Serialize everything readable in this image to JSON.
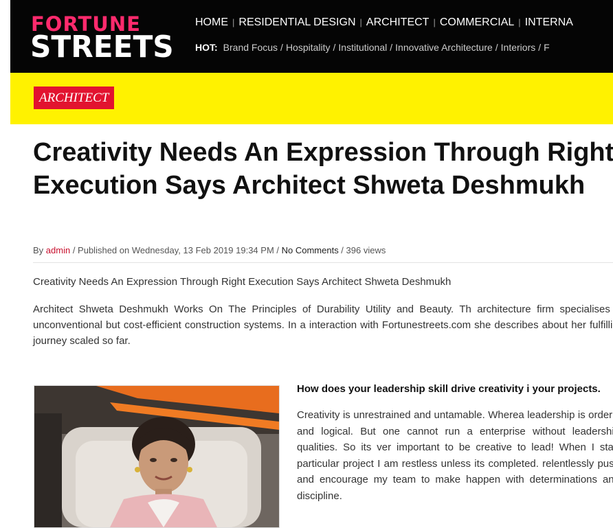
{
  "site": {
    "logo_top": "FORTUNE",
    "logo_bottom": "STREETS"
  },
  "nav": {
    "items": [
      "HOME",
      "RESIDENTIAL DESIGN",
      "ARCHITECT",
      "COMMERCIAL",
      "INTERNA"
    ]
  },
  "hot": {
    "label": "HOT:",
    "links": [
      "Brand Focus",
      "Hospitality",
      "Institutional",
      "Innovative Architecture",
      "Interiors",
      "F"
    ]
  },
  "category": {
    "badge": "ARCHITECT"
  },
  "article": {
    "title": "Creativity Needs An Expression Through Right Execution Says Architect Shweta Deshmukh",
    "meta": {
      "by": "By ",
      "author": "admin",
      "published": " / Published on Wednesday, 13 Feb 2019 19:34 PM / ",
      "comments": "No Comments",
      "views": " / 396 views"
    },
    "lead": "Creativity Needs An Expression Through Right Execution Says Architect Shweta Deshmukh",
    "intro": "Architect Shweta Deshmukh Works On The Principles of Durability Utility and Beauty. Th architecture firm specialises in unconventional but cost-efficient construction systems. In a interaction with Fortunestreets.com she describes about her fulfilling journey scaled so far.",
    "question": "How does your leadership skill drive creativity i your projects.",
    "answer": "Creativity is unrestrained and untamable. Wherea leadership is orderly and logical. But one cannot run a enterprise without leadership qualities. So its ver important to be creative to lead! When I start particular project I am restless unless its completed. relentlessly push and encourage my team to make happen with determinations and discipline."
  },
  "colors": {
    "header_bg": "#050505",
    "band_bg": "#fff200",
    "badge_bg": "#e2132f",
    "logo_accent": "#ff2a6d",
    "link_red": "#c8102e"
  }
}
